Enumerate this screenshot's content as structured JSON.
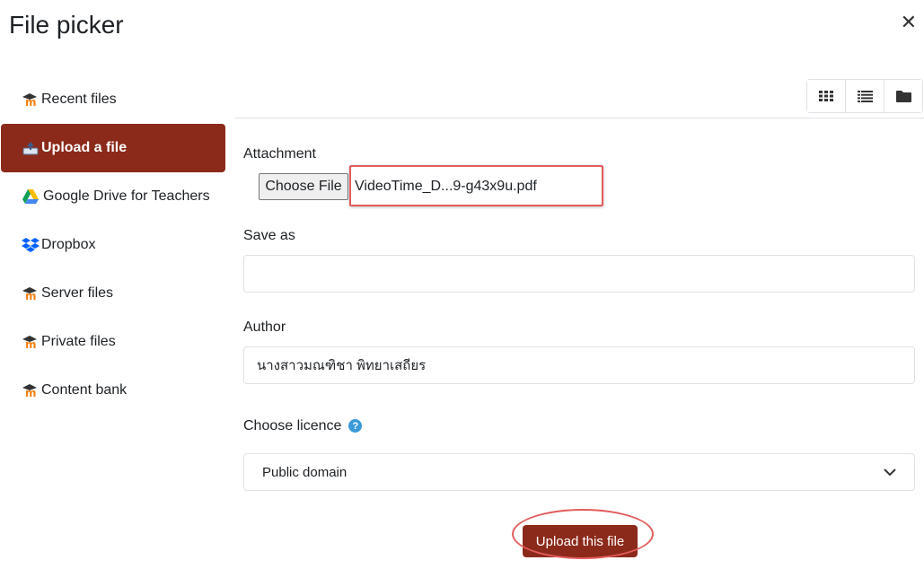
{
  "header": {
    "title": "File picker",
    "close_icon": "close-icon"
  },
  "sidebar": {
    "items": [
      {
        "label": "Recent files",
        "icon": "moodle-icon",
        "active": false
      },
      {
        "label": "Upload a file",
        "icon": "upload-icon",
        "active": true
      },
      {
        "label": "Google Drive for Teachers",
        "icon": "google-drive-icon",
        "active": false
      },
      {
        "label": "Dropbox",
        "icon": "dropbox-icon",
        "active": false
      },
      {
        "label": "Server files",
        "icon": "moodle-icon",
        "active": false
      },
      {
        "label": "Private files",
        "icon": "moodle-icon",
        "active": false
      },
      {
        "label": "Content bank",
        "icon": "moodle-icon",
        "active": false
      }
    ]
  },
  "toolbar": {
    "buttons": [
      "grid-view-icon",
      "list-view-icon",
      "folder-view-icon"
    ]
  },
  "form": {
    "attachment_label": "Attachment",
    "choose_file_label": "Choose File",
    "file_name": "VideoTime_D...9-g43x9u.pdf",
    "save_as_label": "Save as",
    "save_as_value": "",
    "author_label": "Author",
    "author_value": "นางสาวมณฑิชา พิทยาเสถียร",
    "licence_label": "Choose licence",
    "licence_value": "Public domain",
    "upload_button": "Upload this file"
  },
  "colors": {
    "primary": "#8b2a1a",
    "annotation": "#e35b5b",
    "help": "#3a9ad9"
  }
}
